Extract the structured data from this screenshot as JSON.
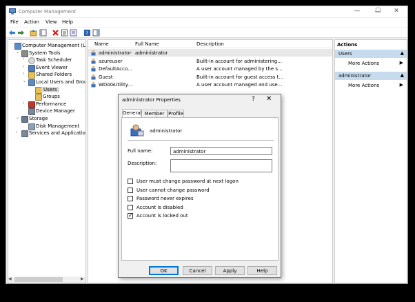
{
  "window": {
    "title": "Computer Management",
    "controls": {
      "minimize": "—",
      "maximize": "☐",
      "close": "✕"
    }
  },
  "menu": [
    "File",
    "Action",
    "View",
    "Help"
  ],
  "tree": [
    {
      "label": "Computer Management (Local",
      "icon": "computer-icon",
      "twisty": "",
      "indent": 0
    },
    {
      "label": "System Tools",
      "icon": "tools-icon",
      "twisty": "⌄",
      "indent": 1
    },
    {
      "label": "Task Scheduler",
      "icon": "clock-icon",
      "twisty": "›",
      "indent": 2
    },
    {
      "label": "Event Viewer",
      "icon": "event-viewer-icon",
      "twisty": "›",
      "indent": 2
    },
    {
      "label": "Shared Folders",
      "icon": "folder-icon",
      "twisty": "›",
      "indent": 2
    },
    {
      "label": "Local Users and Groups",
      "icon": "users-icon",
      "twisty": "⌄",
      "indent": 2
    },
    {
      "label": "Users",
      "icon": "folder-icon",
      "twisty": "",
      "indent": 3,
      "selected": true
    },
    {
      "label": "Groups",
      "icon": "folder-icon",
      "twisty": "",
      "indent": 3
    },
    {
      "label": "Performance",
      "icon": "performance-icon",
      "twisty": "›",
      "indent": 2
    },
    {
      "label": "Device Manager",
      "icon": "device-manager-icon",
      "twisty": "",
      "indent": 2
    },
    {
      "label": "Storage",
      "icon": "storage-icon",
      "twisty": "⌄",
      "indent": 1
    },
    {
      "label": "Disk Management",
      "icon": "disk-icon",
      "twisty": "",
      "indent": 2
    },
    {
      "label": "Services and Applications",
      "icon": "services-icon",
      "twisty": "›",
      "indent": 1
    }
  ],
  "list": {
    "headers": [
      "Name",
      "Full Name",
      "Description"
    ],
    "rows": [
      {
        "name": "administrator",
        "full_name": "administrator",
        "description": "",
        "selected": true
      },
      {
        "name": "azureuser",
        "full_name": "",
        "description": "Built-in account for administering..."
      },
      {
        "name": "DefaultAcco...",
        "full_name": "",
        "description": "A user account managed by the s..."
      },
      {
        "name": "Guest",
        "full_name": "",
        "description": "Built-in account for guest access t..."
      },
      {
        "name": "WDAGUtility...",
        "full_name": "",
        "description": "A user account managed and use..."
      }
    ]
  },
  "actions": {
    "title": "Actions",
    "sections": [
      {
        "header": "Users",
        "item": "More Actions"
      },
      {
        "header": "administrator",
        "item": "More Actions"
      }
    ],
    "collapse_glyph": "▲",
    "expand_glyph": "▶"
  },
  "dialog": {
    "title": "administrator Properties",
    "help_glyph": "?",
    "close_glyph": "✕",
    "tabs": [
      "General",
      "Member Of",
      "Profile"
    ],
    "username": "administrator",
    "full_name_label": "Full name:",
    "full_name_value": "administrator",
    "description_label": "Description:",
    "description_value": "",
    "checkboxes": [
      {
        "label": "User must change password at next logon",
        "checked": false
      },
      {
        "label": "User cannot change password",
        "checked": false
      },
      {
        "label": "Password never expires",
        "checked": false
      },
      {
        "label": "Account is disabled",
        "checked": false
      },
      {
        "label": "Account is locked out",
        "checked": true
      }
    ],
    "buttons": [
      "OK",
      "Cancel",
      "Apply",
      "Help"
    ],
    "check_glyph": "✓"
  },
  "colors": {
    "accent": "#0078d7",
    "action_header": "#c7dbee",
    "selection": "#cce8ff"
  }
}
